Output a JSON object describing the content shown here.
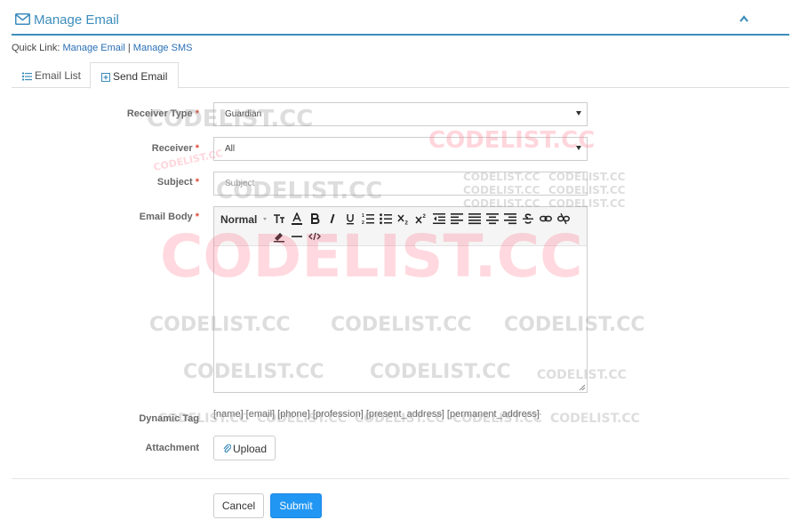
{
  "header": {
    "title": "Manage Email",
    "icon": "envelope-icon",
    "collapse_icon": "chevron-up-icon",
    "accent": "#3c8dbc"
  },
  "quicklinks": {
    "prefix": "Quick Link:",
    "links": [
      "Manage Email",
      "Manage SMS"
    ],
    "separator": "|"
  },
  "tabs": [
    {
      "label": "Email List",
      "icon": "list-icon",
      "active": false
    },
    {
      "label": "Send Email",
      "icon": "plus-square-icon",
      "active": true
    }
  ],
  "form": {
    "required_mark": "*",
    "receiver_type": {
      "label": "Receiver Type",
      "value": "Guardian"
    },
    "receiver": {
      "label": "Receiver",
      "value": "All"
    },
    "subject": {
      "label": "Subject",
      "placeholder": "Subject"
    },
    "email_body": {
      "label": "Email Body",
      "format": "Normal",
      "toolbar_icons": [
        "font-size-icon",
        "font-color-icon",
        "bold-icon",
        "italic-icon",
        "underline-icon",
        "ordered-list-icon",
        "unordered-list-icon",
        "subscript-icon",
        "superscript-icon",
        "outdent-icon",
        "align-left-icon",
        "justify-icon",
        "align-center-icon",
        "align-right-icon",
        "strikethrough-icon",
        "link-icon",
        "unlink-icon",
        "highlight-icon",
        "horizontal-rule-icon",
        "code-view-icon"
      ]
    },
    "dynamic_tag": {
      "label": "Dynamic Tag",
      "value": "[name] [email] [phone] [profession] [present_address] [permanent_address]"
    },
    "attachment": {
      "label": "Attachment",
      "button": "Upload",
      "icon": "paperclip-icon"
    }
  },
  "actions": {
    "cancel": "Cancel",
    "submit": "Submit",
    "submit_color": "#2196f3"
  },
  "watermark": {
    "text": "CODELIST.CC"
  }
}
